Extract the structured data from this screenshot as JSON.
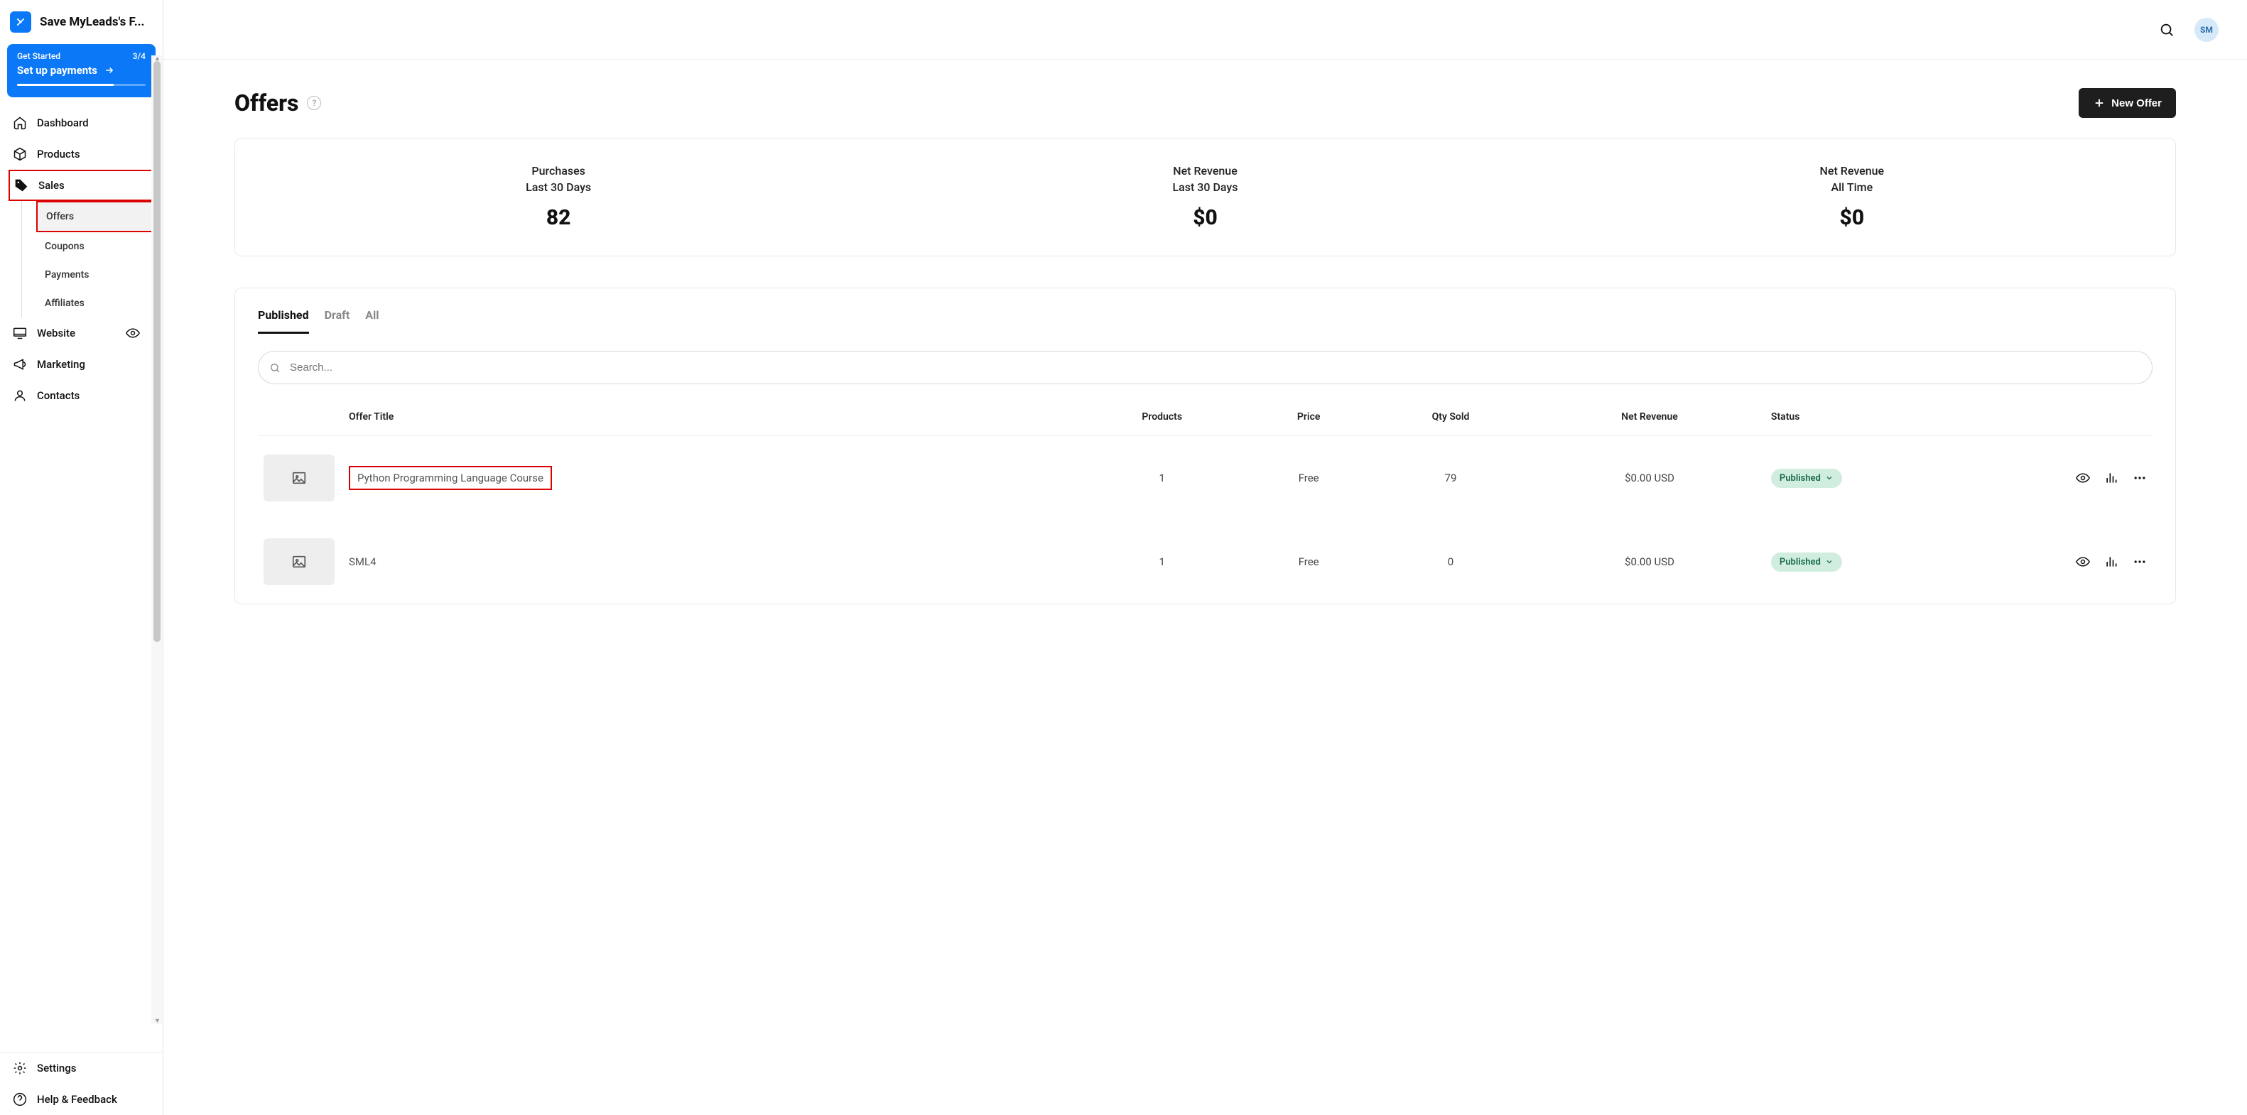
{
  "brand": {
    "label": "Save MyLeads's F..."
  },
  "getStarted": {
    "label": "Get Started",
    "progress": "3/4",
    "title": "Set up payments"
  },
  "nav": {
    "dashboard": "Dashboard",
    "products": "Products",
    "sales": "Sales",
    "offers": "Offers",
    "coupons": "Coupons",
    "payments": "Payments",
    "affiliates": "Affiliates",
    "website": "Website",
    "marketing": "Marketing",
    "contacts": "Contacts",
    "settings": "Settings",
    "help": "Help & Feedback"
  },
  "header": {
    "avatar": "SM"
  },
  "page": {
    "title": "Offers",
    "newOffer": "New Offer"
  },
  "stats": [
    {
      "label": "Purchases",
      "sub": "Last 30 Days",
      "value": "82"
    },
    {
      "label": "Net Revenue",
      "sub": "Last 30 Days",
      "value": "$0"
    },
    {
      "label": "Net Revenue",
      "sub": "All Time",
      "value": "$0"
    }
  ],
  "tabs": {
    "published": "Published",
    "draft": "Draft",
    "all": "All"
  },
  "search": {
    "placeholder": "Search..."
  },
  "table": {
    "cols": {
      "title": "Offer Title",
      "products": "Products",
      "price": "Price",
      "qty": "Qty Sold",
      "net": "Net Revenue",
      "status": "Status"
    },
    "rows": [
      {
        "title": "Python Programming Language Course",
        "products": "1",
        "price": "Free",
        "qty": "79",
        "net": "$0.00 USD",
        "status": "Published"
      },
      {
        "title": "SML4",
        "products": "1",
        "price": "Free",
        "qty": "0",
        "net": "$0.00 USD",
        "status": "Published"
      }
    ]
  }
}
